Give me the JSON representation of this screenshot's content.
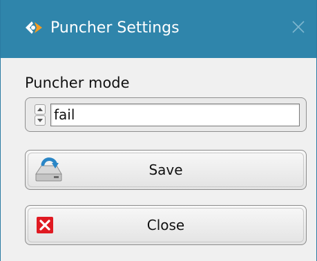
{
  "window": {
    "title": "Puncher Settings",
    "app_icon": "puncher-app-icon",
    "close_icon": "close-icon"
  },
  "mode": {
    "label": "Puncher mode",
    "value": "fail",
    "spinner_icons": [
      "chevron-up-icon",
      "chevron-down-icon"
    ]
  },
  "buttons": {
    "save_label": "Save",
    "save_icon": "drive-save-icon",
    "close_label": "Close",
    "close_icon": "error-x-icon"
  },
  "colors": {
    "titlebar": "#2f85ab",
    "error_icon": "#e01a22"
  }
}
